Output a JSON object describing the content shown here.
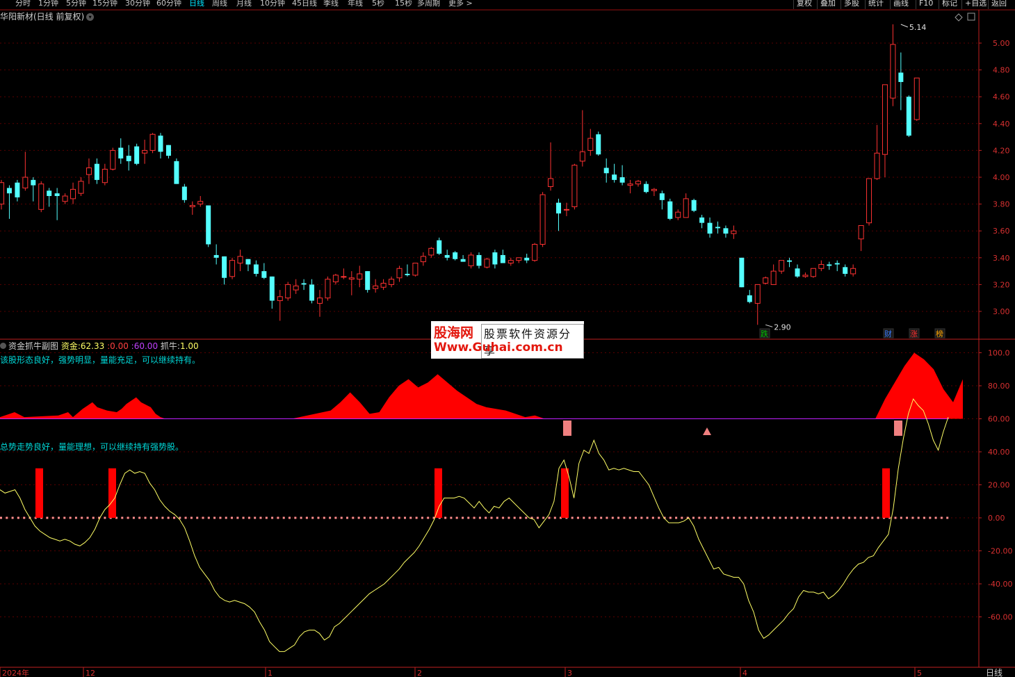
{
  "toolbar": {
    "periods": [
      {
        "label": "分时",
        "active": false
      },
      {
        "label": "1分钟",
        "active": false
      },
      {
        "label": "5分钟",
        "active": false
      },
      {
        "label": "15分钟",
        "active": false
      },
      {
        "label": "30分钟",
        "active": false
      },
      {
        "label": "60分钟",
        "active": false
      },
      {
        "label": "日线",
        "active": true
      },
      {
        "label": "周线",
        "active": false
      },
      {
        "label": "月线",
        "active": false
      },
      {
        "label": "10分钟",
        "active": false
      },
      {
        "label": "45日线",
        "active": false
      },
      {
        "label": "季线",
        "active": false
      },
      {
        "label": "年线",
        "active": false
      },
      {
        "label": "5秒",
        "active": false
      },
      {
        "label": "15秒",
        "active": false
      },
      {
        "label": "多周期",
        "active": false
      },
      {
        "label": "更多 >",
        "active": false
      }
    ],
    "right_buttons": [
      "复权",
      "叠加",
      "多股",
      "统计",
      "画线",
      "F10",
      "标记",
      "+自选",
      "返回"
    ]
  },
  "main_title": "华阳新材(日线 前复权)",
  "price_axis": [
    "5.00",
    "4.80",
    "4.60",
    "4.40",
    "4.20",
    "4.00",
    "3.80",
    "3.60",
    "3.40",
    "3.20",
    "3.00"
  ],
  "high_mark": "5.14",
  "low_mark": "2.90",
  "event_marks": [
    {
      "text": "跌",
      "color": "#00c000"
    },
    {
      "text": "财",
      "color": "#3a7bff"
    },
    {
      "text": "涨",
      "color": "#ff3030"
    },
    {
      "text": "榜",
      "color": "#ffa500"
    }
  ],
  "indicator": {
    "name": "资金抓牛副图",
    "fund_label": "资金:",
    "fund_value": "62.33",
    "zero_value": "0.00",
    "sixty_value": "60.00",
    "catch_label": "抓牛:",
    "catch_value": "1.00"
  },
  "notes": [
    "该股形态良好，强势明显，量能充足，可以继续持有。",
    "总势走势良好，量能理想，可以继续持有强势股。"
  ],
  "indicator_axis": [
    "100.0",
    "80.00",
    "60.00",
    "40.00",
    "20.00",
    "0.00",
    "-20.00",
    "-40.00",
    "-60.00"
  ],
  "date_axis": [
    "2024年",
    "12",
    "1",
    "2",
    "3",
    "4",
    "5"
  ],
  "period_label": "日线",
  "watermark": {
    "logo": "股海网",
    "slogan": "股票软件资源分享",
    "url": "Www.Guhai.com.cn"
  },
  "colors": {
    "up": "#ff3232",
    "down": "#54ffff",
    "grid": "#5a0000",
    "axis": "#c02020",
    "fund_line": "#ffff66",
    "fund_area": "#ff0000",
    "level_line": "#c020ff"
  },
  "chart_data": {
    "type": "candlestick",
    "ohlc": [
      [
        3.8,
        3.98,
        3.76,
        3.96
      ],
      [
        3.92,
        3.94,
        3.69,
        3.88
      ],
      [
        3.96,
        3.98,
        3.82,
        3.85
      ],
      [
        3.92,
        4.19,
        3.9,
        4.0
      ],
      [
        3.98,
        4.0,
        3.82,
        3.94
      ],
      [
        3.76,
        3.97,
        3.74,
        3.95
      ],
      [
        3.9,
        3.92,
        3.78,
        3.86
      ],
      [
        3.88,
        3.92,
        3.68,
        3.86
      ],
      [
        3.82,
        3.88,
        3.8,
        3.86
      ],
      [
        3.84,
        3.96,
        3.8,
        3.91
      ],
      [
        3.88,
        4.0,
        3.86,
        3.97
      ],
      [
        4.02,
        4.14,
        3.95,
        4.07
      ],
      [
        4.1,
        4.14,
        3.95,
        3.98
      ],
      [
        3.96,
        4.1,
        3.94,
        4.06
      ],
      [
        4.06,
        4.22,
        4.05,
        4.2
      ],
      [
        4.22,
        4.29,
        4.1,
        4.14
      ],
      [
        4.16,
        4.24,
        4.05,
        4.12
      ],
      [
        4.23,
        4.25,
        4.09,
        4.1
      ],
      [
        4.18,
        4.28,
        4.1,
        4.2
      ],
      [
        4.2,
        4.33,
        4.18,
        4.32
      ],
      [
        4.31,
        4.33,
        4.14,
        4.19
      ],
      [
        4.24,
        4.24,
        4.14,
        4.16
      ],
      [
        4.12,
        4.14,
        3.95,
        3.95
      ],
      [
        3.93,
        3.95,
        3.81,
        3.83
      ],
      [
        3.78,
        3.82,
        3.72,
        3.79
      ],
      [
        3.8,
        3.86,
        3.78,
        3.82
      ],
      [
        3.79,
        3.79,
        3.48,
        3.5
      ],
      [
        3.42,
        3.5,
        3.35,
        3.4
      ],
      [
        3.41,
        3.41,
        3.2,
        3.25
      ],
      [
        3.26,
        3.4,
        3.24,
        3.38
      ],
      [
        3.36,
        3.46,
        3.3,
        3.41
      ],
      [
        3.39,
        3.39,
        3.3,
        3.35
      ],
      [
        3.35,
        3.38,
        3.26,
        3.28
      ],
      [
        3.3,
        3.36,
        3.24,
        3.25
      ],
      [
        3.26,
        3.26,
        3.02,
        3.08
      ],
      [
        3.08,
        3.16,
        2.93,
        3.11
      ],
      [
        3.1,
        3.22,
        3.08,
        3.2
      ],
      [
        3.16,
        3.24,
        3.13,
        3.19
      ],
      [
        3.21,
        3.24,
        3.16,
        3.2
      ],
      [
        3.2,
        3.24,
        3.06,
        3.08
      ],
      [
        3.06,
        3.16,
        2.96,
        3.1
      ],
      [
        3.1,
        3.26,
        3.08,
        3.24
      ],
      [
        3.22,
        3.28,
        3.2,
        3.27
      ],
      [
        3.26,
        3.32,
        3.24,
        3.26
      ],
      [
        3.24,
        3.3,
        3.12,
        3.25
      ],
      [
        3.24,
        3.34,
        3.18,
        3.28
      ],
      [
        3.3,
        3.3,
        3.14,
        3.16
      ],
      [
        3.17,
        3.24,
        3.14,
        3.19
      ],
      [
        3.18,
        3.24,
        3.16,
        3.21
      ],
      [
        3.2,
        3.26,
        3.18,
        3.24
      ],
      [
        3.25,
        3.34,
        3.22,
        3.32
      ],
      [
        3.28,
        3.35,
        3.26,
        3.27
      ],
      [
        3.27,
        3.36,
        3.26,
        3.36
      ],
      [
        3.37,
        3.44,
        3.34,
        3.41
      ],
      [
        3.42,
        3.48,
        3.4,
        3.47
      ],
      [
        3.53,
        3.55,
        3.42,
        3.43
      ],
      [
        3.42,
        3.46,
        3.38,
        3.4
      ],
      [
        3.44,
        3.45,
        3.38,
        3.39
      ],
      [
        3.39,
        3.42,
        3.37,
        3.37
      ],
      [
        3.34,
        3.44,
        3.32,
        3.42
      ],
      [
        3.42,
        3.44,
        3.32,
        3.34
      ],
      [
        3.33,
        3.4,
        3.32,
        3.39
      ],
      [
        3.44,
        3.46,
        3.32,
        3.35
      ],
      [
        3.42,
        3.46,
        3.38,
        3.36
      ],
      [
        3.36,
        3.4,
        3.34,
        3.38
      ],
      [
        3.38,
        3.4,
        3.36,
        3.4
      ],
      [
        3.4,
        3.43,
        3.36,
        3.38
      ],
      [
        3.38,
        3.51,
        3.37,
        3.5
      ],
      [
        3.5,
        3.89,
        3.48,
        3.87
      ],
      [
        3.93,
        4.26,
        3.9,
        3.99
      ],
      [
        3.81,
        3.84,
        3.6,
        3.73
      ],
      [
        3.76,
        3.81,
        3.71,
        3.76
      ],
      [
        3.78,
        4.1,
        3.76,
        4.09
      ],
      [
        4.12,
        4.5,
        4.08,
        4.19
      ],
      [
        4.2,
        4.36,
        4.16,
        4.29
      ],
      [
        4.32,
        4.34,
        4.16,
        4.17
      ],
      [
        4.07,
        4.14,
        3.96,
        4.03
      ],
      [
        4.02,
        4.1,
        3.96,
        3.98
      ],
      [
        4.0,
        4.09,
        3.94,
        3.96
      ],
      [
        3.94,
        3.98,
        3.88,
        3.95
      ],
      [
        3.95,
        3.98,
        3.93,
        3.97
      ],
      [
        3.95,
        3.97,
        3.88,
        3.89
      ],
      [
        3.9,
        3.92,
        3.86,
        3.91
      ],
      [
        3.88,
        3.9,
        3.76,
        3.83
      ],
      [
        3.82,
        3.84,
        3.68,
        3.69
      ],
      [
        3.7,
        3.76,
        3.68,
        3.74
      ],
      [
        3.7,
        3.88,
        3.7,
        3.84
      ],
      [
        3.83,
        3.84,
        3.74,
        3.75
      ],
      [
        3.7,
        3.72,
        3.62,
        3.66
      ],
      [
        3.66,
        3.7,
        3.55,
        3.58
      ],
      [
        3.63,
        3.67,
        3.58,
        3.62
      ],
      [
        3.62,
        3.64,
        3.55,
        3.58
      ],
      [
        3.58,
        3.64,
        3.54,
        3.6
      ],
      [
        3.4,
        3.4,
        3.18,
        3.18
      ],
      [
        3.12,
        3.16,
        3.06,
        3.07
      ],
      [
        3.06,
        3.2,
        2.9,
        3.2
      ],
      [
        3.21,
        3.26,
        3.2,
        3.25
      ],
      [
        3.2,
        3.35,
        3.2,
        3.3
      ],
      [
        3.3,
        3.37,
        3.28,
        3.38
      ],
      [
        3.38,
        3.4,
        3.33,
        3.37
      ],
      [
        3.32,
        3.35,
        3.25,
        3.26
      ],
      [
        3.26,
        3.29,
        3.25,
        3.27
      ],
      [
        3.26,
        3.31,
        3.25,
        3.32
      ],
      [
        3.32,
        3.38,
        3.3,
        3.35
      ],
      [
        3.35,
        3.37,
        3.31,
        3.34
      ],
      [
        3.36,
        3.38,
        3.3,
        3.35
      ],
      [
        3.33,
        3.35,
        3.26,
        3.28
      ],
      [
        3.28,
        3.35,
        3.26,
        3.32
      ],
      [
        3.54,
        3.64,
        3.45,
        3.64
      ],
      [
        3.66,
        3.67,
        3.64,
        3.99
      ],
      [
        3.99,
        4.39,
        3.98,
        4.18
      ],
      [
        4.17,
        4.66,
        4.0,
        4.69
      ],
      [
        4.59,
        5.14,
        4.53,
        4.99
      ],
      [
        4.78,
        4.93,
        4.5,
        4.71
      ],
      [
        4.6,
        4.61,
        4.3,
        4.31
      ],
      [
        4.43,
        4.72,
        4.42,
        4.74
      ]
    ],
    "fund": [
      17,
      15,
      16,
      17,
      12,
      5,
      0,
      -5,
      -8,
      -10,
      -12,
      -13,
      -14,
      -13,
      -14,
      -16,
      -17,
      -15,
      -12,
      -7,
      0,
      5,
      8,
      12,
      20,
      27,
      29,
      27,
      28,
      27,
      21,
      17,
      11,
      7,
      4,
      2,
      -1,
      -6,
      -14,
      -23,
      -30,
      -34,
      -38,
      -44,
      -48,
      -50,
      -51,
      -50,
      -51,
      -52,
      -54,
      -57,
      -63,
      -68,
      -75,
      -78,
      -81,
      -81,
      -79,
      -77,
      -72,
      -69,
      -68,
      -68,
      -70,
      -74,
      -72,
      -66,
      -64,
      -61,
      -58,
      -55,
      -52,
      -49,
      -46,
      -44,
      -42,
      -40,
      -37,
      -34,
      -31,
      -27,
      -24,
      -21,
      -17,
      -12,
      -7,
      -1,
      7,
      12,
      12,
      12,
      13,
      12,
      9,
      6,
      10,
      6,
      3,
      7,
      6,
      10,
      12,
      9,
      6,
      3,
      0,
      -1,
      -6,
      -2,
      2,
      10,
      30,
      35,
      25,
      12,
      33,
      41,
      39,
      47,
      39,
      35,
      29,
      30,
      29,
      30,
      29,
      28,
      28,
      24,
      20,
      13,
      6,
      0,
      -3,
      -3,
      -3,
      -2,
      0,
      -5,
      -13,
      -19,
      -25,
      -31,
      -30,
      -34,
      -35,
      -36,
      -36,
      -40,
      -50,
      -57,
      -68,
      -73,
      -71,
      -68,
      -65,
      -62,
      -58,
      -55,
      -48,
      -44,
      -45,
      -45,
      -46,
      -45,
      -49,
      -47,
      -44,
      -40,
      -35,
      -31,
      -28,
      -27,
      -24,
      -23,
      -18,
      -14,
      -10,
      6,
      30,
      48,
      63,
      72,
      68,
      65,
      57,
      47,
      41,
      52,
      61
    ],
    "fund_above60": [
      [
        0,
        1
      ],
      [
        2,
        3
      ],
      [
        3,
        4
      ],
      [
        5,
        1
      ],
      [
        12,
        2
      ],
      [
        14,
        4
      ],
      [
        15,
        1
      ],
      [
        17,
        6
      ],
      [
        19,
        10
      ],
      [
        20,
        7
      ],
      [
        22,
        5
      ],
      [
        24,
        4
      ],
      [
        25,
        6
      ],
      [
        26,
        9
      ],
      [
        28,
        13
      ],
      [
        29,
        10
      ],
      [
        31,
        7
      ],
      [
        32,
        3
      ],
      [
        33,
        1
      ],
      [
        34,
        0
      ],
      [
        60,
        0
      ],
      [
        68,
        5
      ],
      [
        70,
        10
      ],
      [
        72,
        16
      ],
      [
        74,
        10
      ],
      [
        76,
        3
      ],
      [
        78,
        4
      ],
      [
        80,
        13
      ],
      [
        82,
        20
      ],
      [
        84,
        24
      ],
      [
        86,
        19
      ],
      [
        88,
        22
      ],
      [
        90,
        27
      ],
      [
        92,
        22
      ],
      [
        94,
        17
      ],
      [
        96,
        13
      ],
      [
        98,
        9
      ],
      [
        100,
        7
      ],
      [
        102,
        6
      ],
      [
        104,
        5
      ],
      [
        106,
        3
      ],
      [
        108,
        1
      ],
      [
        110,
        2
      ],
      [
        112,
        0
      ],
      [
        180,
        0
      ],
      [
        182,
        12
      ],
      [
        184,
        22
      ],
      [
        186,
        32
      ],
      [
        188,
        40
      ],
      [
        190,
        36
      ],
      [
        192,
        30
      ],
      [
        194,
        18
      ],
      [
        196,
        10
      ],
      [
        198,
        24
      ]
    ],
    "catch_signal_days": [
      8,
      23,
      90,
      116,
      182
    ],
    "ylim_price": [
      2.85,
      5.15
    ],
    "ylim_fund": [
      -80,
      105
    ],
    "level_line": 60,
    "zero_line": 0
  }
}
